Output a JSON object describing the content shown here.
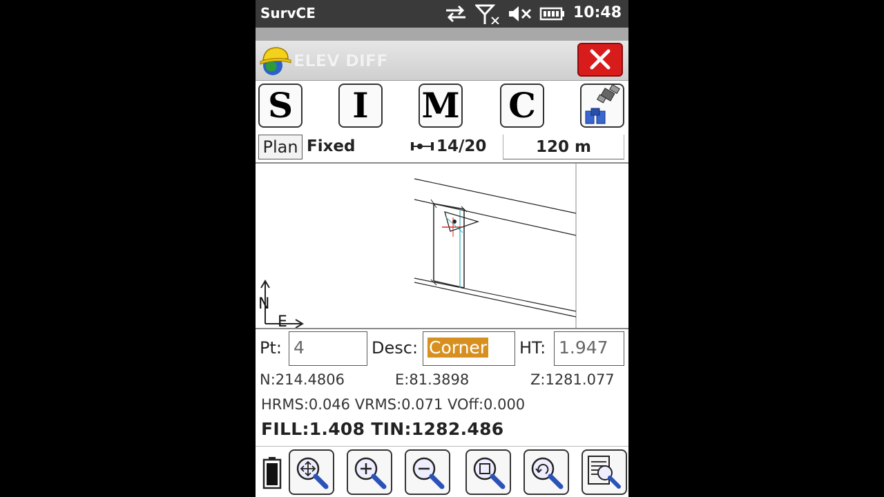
{
  "os_status": {
    "app_name": "SurvCE",
    "time": "10:48"
  },
  "window": {
    "title": "ELEV DIFF",
    "close_icon": "close-icon"
  },
  "toolbar": {
    "buttons": [
      {
        "label": "S"
      },
      {
        "label": "I"
      },
      {
        "label": "M"
      },
      {
        "label": "C"
      }
    ],
    "satellite_icon": "satellite-binoculars-icon"
  },
  "status_row": {
    "view_mode": "Plan",
    "solution": "Fixed",
    "satellites": "14/20",
    "scale": "120 m"
  },
  "map": {
    "north_label": "N",
    "east_label": "E"
  },
  "point_form": {
    "pt_label": "Pt:",
    "pt_value": "4",
    "desc_label": "Desc:",
    "desc_value": "Corner",
    "ht_label": "HT:",
    "ht_value": "1.947"
  },
  "coords": {
    "n": "N:214.4806",
    "e": "E:81.3898",
    "z": "Z:1281.077"
  },
  "rms": "HRMS:0.046 VRMS:0.071 VOff:0.000",
  "fill": "FILL:1.408 TIN:1282.486",
  "bottom_toolbar": [
    {
      "icon": "zoom-extents-icon"
    },
    {
      "icon": "zoom-in-icon"
    },
    {
      "icon": "zoom-out-icon"
    },
    {
      "icon": "zoom-window-icon"
    },
    {
      "icon": "zoom-previous-icon"
    },
    {
      "icon": "map-settings-icon"
    }
  ],
  "colors": {
    "close_red": "#d81b1b",
    "selection_orange": "#d7901f",
    "status_bar": "#3a3a3a"
  }
}
